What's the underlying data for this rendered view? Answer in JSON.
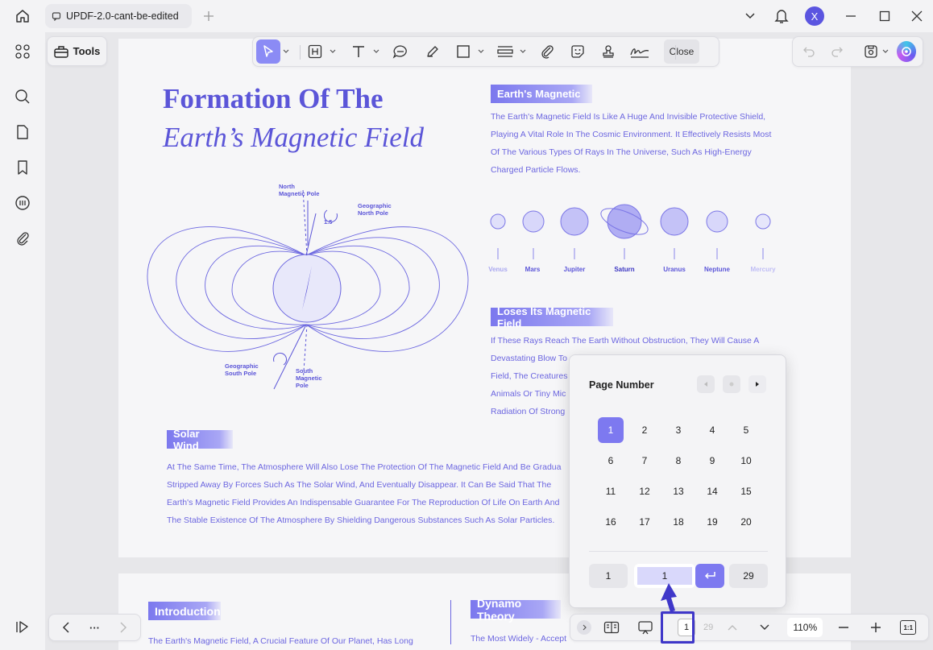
{
  "window": {
    "tab_title": "UPDF-2.0-cant-be-edited",
    "avatar_letter": "X"
  },
  "toolbar": {
    "tools_label": "Tools",
    "close_label": "Close"
  },
  "document": {
    "title_line1": "Formation Of The",
    "title_line2": "Earth’s Magnetic Field",
    "diagram_labels": {
      "north_magnetic": "North\nMagnetic Pole",
      "geo_north": "Geographic\nNorth Pole",
      "angle": "1.5",
      "geo_south": "Geographic\nSouth Pole",
      "south_magnetic": "South\nMagnetic\nPole"
    },
    "sec1_tag": "Earth's Magnetic",
    "sec1_lines": [
      "The Earth's Magnetic Field Is Like A Huge And Invisible Protective Shield,",
      "Playing A Vital Role In The Cosmic Environment. It Effectively Resists Most",
      "Of The Various Types Of Rays In The Universe, Such As High-Energy",
      "Charged Particle Flows."
    ],
    "planets": [
      "Venus",
      "Mars",
      "Jupiter",
      "Saturn",
      "Uranus",
      "Neptune",
      "Mercury"
    ],
    "sec2_tag": "Loses Its Magnetic Field",
    "sec2_lines": [
      "If These Rays Reach The Earth Without Obstruction, They Will Cause A",
      "Devastating Blow To",
      "Field, The Creatures",
      "Animals Or Tiny Mic",
      "Radiation Of Strong"
    ],
    "sec3_tag": "Solar Wind",
    "sec3_lines": [
      "At The Same Time, The Atmosphere Will Also Lose The Protection Of The Magnetic Field And Be Gradua",
      "Stripped Away By Forces Such As The Solar Wind, And Eventually Disappear. It Can Be Said That The",
      "Earth's Magnetic Field Provides An Indispensable Guarantee For The Reproduction Of Life On Earth And",
      "The Stable Existence Of The Atmosphere By Shielding Dangerous Substances Such As Solar Particles."
    ],
    "p2_tag1": "Introduction",
    "p2_text1": "The Earth's Magnetic Field, A Crucial Feature Of Our Planet, Has Long",
    "p2_tag2": "Dynamo Theory",
    "p2_text2": "The Most Widely - Accept"
  },
  "popup": {
    "title": "Page Number",
    "pages": [
      "1",
      "2",
      "3",
      "4",
      "5",
      "6",
      "7",
      "8",
      "9",
      "10",
      "11",
      "12",
      "13",
      "14",
      "15",
      "16",
      "17",
      "18",
      "19",
      "20"
    ],
    "current_page": "1",
    "first": "1",
    "input_value": "1",
    "last": "29"
  },
  "bottom": {
    "nav_more": "···",
    "current_page": "1",
    "total_pages": "29",
    "zoom": "110%",
    "fit_label": "1:1"
  },
  "colors": {
    "accent": "#8b8bf5",
    "brand": "#5b55d8",
    "highlight_box": "#3f37c9"
  }
}
